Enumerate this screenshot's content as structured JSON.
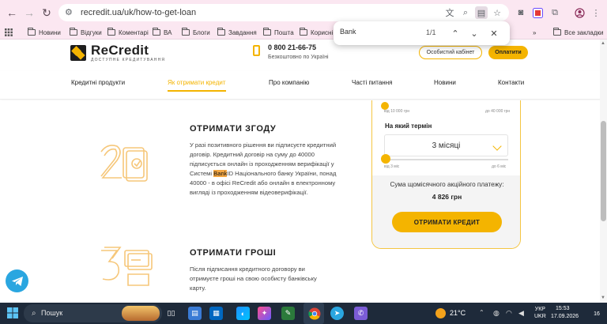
{
  "browser": {
    "url": "recredit.ua/uk/how-to-get-loan",
    "find": {
      "query": "Bank",
      "count": "1/1"
    },
    "bookmarks": [
      "Новини",
      "Відгуки",
      "Коментарі",
      "ВА",
      "Блоги",
      "Завдання",
      "Пошта",
      "Корисні"
    ],
    "all_bookmarks_label": "Все закладки",
    "more_bookmarks": "»"
  },
  "header": {
    "logo_name": "ReCredit",
    "logo_tagline": "ДОСТУПНЕ КРЕДИТУВАННЯ",
    "phone": "0 800 21-66-75",
    "phone_note": "Безкоштовно по Україні",
    "cabinet_button": "Особистий кабінет",
    "pay_button": "Оплатити"
  },
  "nav": {
    "items": [
      "Кредитні продукти",
      "Як отримати кредит",
      "Про компанію",
      "Часті питання",
      "Новини",
      "Контакти"
    ],
    "active_index": 1
  },
  "steps": [
    {
      "title": "ОТРИМАТИ ЗГОДУ",
      "text_before": "У разі позитивного рішення ви підписуєте кредитний договір. Кредитний договір на суму до 40000 підписується онлайн із проходженням верифікації у Системі ",
      "highlight": "Bank",
      "text_after": "ID Національного банку України, понад 40000 - в офісі ReCredit або онлайн в електронному вигляді із проходженням відеоверифікації."
    },
    {
      "title": "ОТРИМАТИ ГРОШІ",
      "text": "Після підписання кредитного договору ви отримуєте гроші на свою особисту банківську карту."
    }
  ],
  "calculator": {
    "amount_min": "від 10 000 грн",
    "amount_max": "до 40 000 грн",
    "term_label": "На який термін",
    "term_value": "3 місяці",
    "term_min": "від 3 міс",
    "term_max": "до 6 міс",
    "payment_label": "Сума щомісячного акційного платежу:",
    "payment_value": "4 826 грн",
    "cta": "ОТРИМАТИ КРЕДИТ"
  },
  "taskbar": {
    "search_placeholder": "Пошук",
    "weather": "21°C",
    "lang_1": "УКР",
    "lang_2": "UKR",
    "time": "15:53",
    "date": "17.09.2026",
    "notifications": "16"
  }
}
